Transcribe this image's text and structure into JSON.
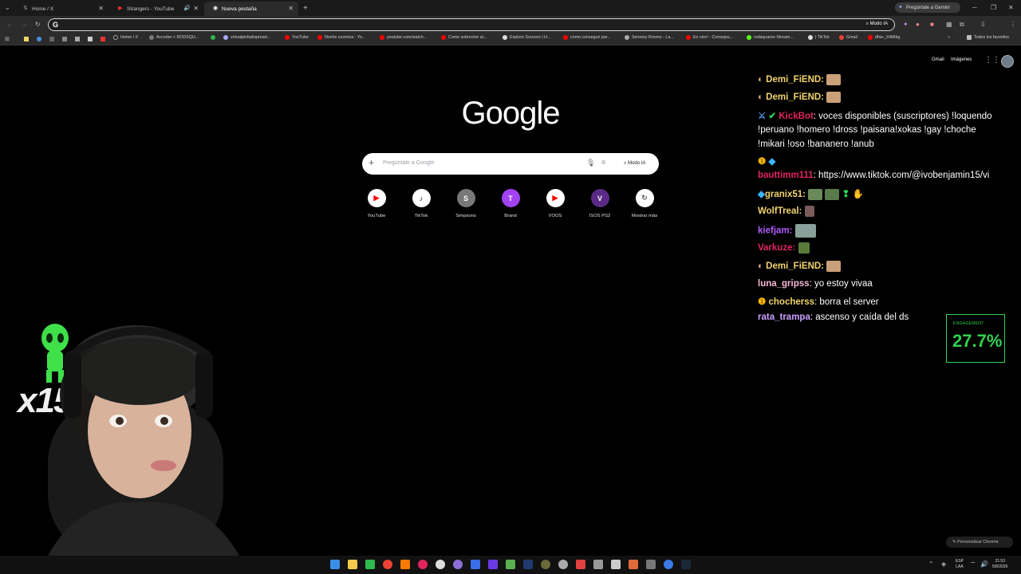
{
  "browser": {
    "tabs": [
      {
        "label": "Home / X",
        "icon": "x-logo-icon"
      },
      {
        "label": "Strangers - YouTube",
        "icon": "youtube-icon"
      },
      {
        "label": "Nueva pestaña",
        "icon": "chrome-icon"
      }
    ],
    "omnibox_value": "",
    "modo_ia_label": "Modo IA",
    "gemini_button": "Pregúntale a Gemini",
    "bookmarks": [
      "Home / X",
      "Acceder < RODSQU...",
      "virtualpinballspread...",
      "YouTube",
      "Noche cosmica - Yo...",
      "youtube.com/watch...",
      "Como sobrevivir al...",
      "Explore Sources | H...",
      "como conseguir par...",
      "Sensory Rooms - La...",
      "En vivo! - Consejos...",
      "rodsquaree Stream...",
      "| TikTok",
      "Gmail",
      "dhw-_hWAkg"
    ],
    "all_bookmarks": "Todos los favoritos"
  },
  "newtab": {
    "header_links": [
      "Gmail",
      "Imágenes"
    ],
    "logo_text": "Google",
    "search_placeholder": "Pregúntale a Google",
    "modo_ia": "Modo IA",
    "shortcuts": [
      {
        "label": "YouTube",
        "glyph": "▶",
        "color": "#ff0000"
      },
      {
        "label": "TikTok",
        "glyph": "♪",
        "color": "#000000"
      },
      {
        "label": "Simpsons",
        "glyph": "S",
        "color": "#5f6368"
      },
      {
        "label": "Brand",
        "glyph": "T",
        "color": "#a142f4"
      },
      {
        "label": "VOOS",
        "glyph": "▶",
        "color": "#ff0000"
      },
      {
        "label": "ISOS PS2",
        "glyph": "V",
        "color": "#5b2a86"
      },
      {
        "label": "Mostrar más",
        "glyph": "↻",
        "color": "#5f6368"
      }
    ],
    "customize": "Personalizar Chrome"
  },
  "chat": [
    {
      "user": "Demi_FiEND:",
      "msg": "",
      "color": "#f2d46b"
    },
    {
      "user": "Demi_FiEND:",
      "msg": "",
      "color": "#f2d46b"
    },
    {
      "user": "KickBot",
      "msg": ": voces disponibles (suscriptores) !loquendo",
      "color": "#e0245e"
    },
    {
      "user": "",
      "msg": "!peruano !homero !dross !paisana!xokas !gay !choche",
      "color": "#ffffff"
    },
    {
      "user": "",
      "msg": "!mikari !oso !bananero !anub",
      "color": "#ffffff"
    },
    {
      "user": "",
      "msg": "",
      "color": "#ffffff"
    },
    {
      "user": "bauttimm111",
      "msg": ": https://www.tiktok.com/@ivobenjamin15/vi",
      "color": "#e0245e"
    },
    {
      "user": "granix51:",
      "msg": "",
      "color": "#f2d46b"
    },
    {
      "user": "WolfTreal:",
      "msg": "",
      "color": "#f2d46b"
    },
    {
      "user": "kiefjam:",
      "msg": "",
      "color": "#b05cff"
    },
    {
      "user": "Varkuze:",
      "msg": "",
      "color": "#e0245e"
    },
    {
      "user": "Demi_FiEND:",
      "msg": "",
      "color": "#f2d46b"
    },
    {
      "user": "luna_gripss",
      "msg": ": yo estoy vivaa",
      "color": "#f7b8d6"
    },
    {
      "user": "chocherss",
      "msg": ": borra el server",
      "color": "#f2d46b"
    },
    {
      "user": "rata_trampa",
      "msg": ": ascenso y caída del ds",
      "color": "#c9a0ff"
    }
  ],
  "engagement": {
    "label": "ENGAGEMENT",
    "value": "27.7%"
  },
  "overlay": {
    "multiplier": "x15"
  },
  "taskbar": {
    "lang": "ESP",
    "lang2": "LAA",
    "time": "21:53",
    "date": "5/8/2026"
  },
  "colors": {
    "accent_green": "#2fd24f"
  }
}
